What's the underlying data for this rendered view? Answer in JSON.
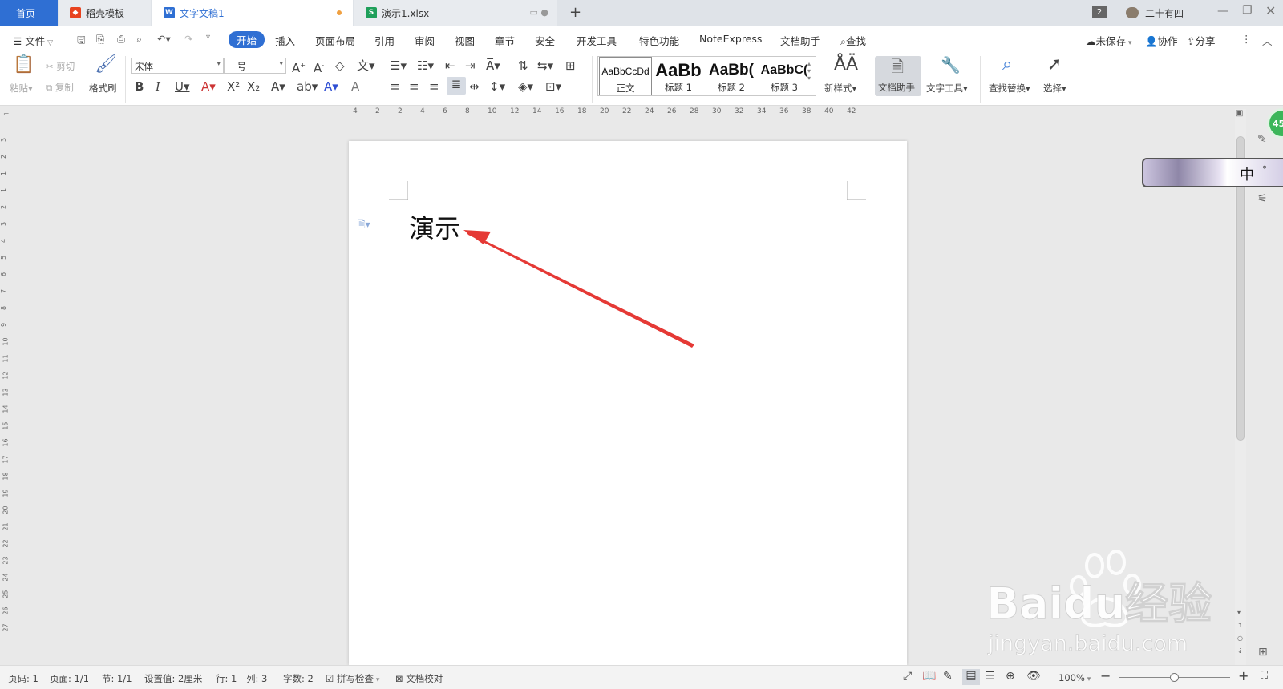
{
  "tabs": {
    "home": "首页",
    "daoke": "稻壳模板",
    "doc": "文字文稿1",
    "xlsx": "演示1.xlsx",
    "new_tab": "+"
  },
  "window": {
    "badge_count": "2",
    "user_name": "二十有四"
  },
  "menu": {
    "file": "文件",
    "items": [
      "开始",
      "插入",
      "页面布局",
      "引用",
      "审阅",
      "视图",
      "章节",
      "安全",
      "开发工具",
      "特色功能",
      "NoteExpress",
      "文档助手"
    ],
    "search": "查找",
    "unsaved": "未保存",
    "collab": "协作",
    "share": "分享"
  },
  "ribbon": {
    "paste": "粘贴",
    "cut": "剪切",
    "copy": "复制",
    "format_painter": "格式刷",
    "font_name": "宋体",
    "font_size": "一号",
    "styles": [
      {
        "preview": "AaBbCcDd",
        "name": "正文"
      },
      {
        "preview": "AaBb",
        "name": "标题 1"
      },
      {
        "preview": "AaBb(",
        "name": "标题 2"
      },
      {
        "preview": "AaBbC(",
        "name": "标题 3"
      }
    ],
    "new_style": "新样式",
    "doc_assistant": "文档助手",
    "text_tools": "文字工具",
    "find_replace": "查找替换",
    "select": "选择"
  },
  "ruler": {
    "ticks": [
      "4",
      "2",
      "2",
      "4",
      "6",
      "8",
      "10",
      "12",
      "14",
      "16",
      "18",
      "20",
      "22",
      "24",
      "26",
      "28",
      "30",
      "32",
      "34",
      "36",
      "38",
      "40",
      "42"
    ],
    "vticks": [
      "3",
      "2",
      "1",
      "1",
      "2",
      "3",
      "4",
      "5",
      "6",
      "7",
      "8",
      "9",
      "10",
      "11",
      "12",
      "13",
      "14",
      "15",
      "16",
      "17",
      "18",
      "19",
      "20",
      "21",
      "22",
      "23",
      "24",
      "25",
      "26",
      "27"
    ]
  },
  "document": {
    "text": "演示"
  },
  "status": {
    "page_num": "页码: 1",
    "pages": "页面: 1/1",
    "section": "节: 1/1",
    "setting": "设置值: 2厘米",
    "row": "行: 1",
    "col": "列: 3",
    "word_count": "字数: 2",
    "spell_check": "拼写检查",
    "doc_proof": "文档校对",
    "zoom": "100%"
  },
  "ime": {
    "lang": "中"
  },
  "badge": {
    "value": "45"
  },
  "watermark": {
    "brand": "Baidu经验",
    "url": "jingyan.baidu.com"
  },
  "colors": {
    "accent": "#2f6fd3",
    "arrow": "#e53935"
  }
}
